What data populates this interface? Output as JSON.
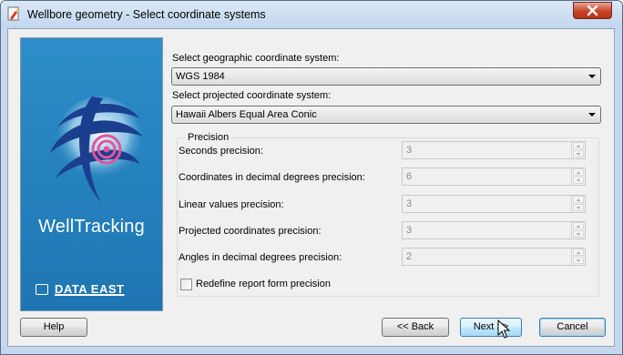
{
  "window": {
    "title": "Wellbore geometry - Select coordinate systems",
    "app_icon": "document-pencil-icon",
    "close_icon": "close-x-icon"
  },
  "banner": {
    "brand": "WellTracking",
    "vendor": "DATA EAST",
    "logo_icon": "globe-target-icon",
    "colors": {
      "background": "#2684c0",
      "globe": "#1b3f8f",
      "target": "#e0559b"
    }
  },
  "geo": {
    "label": "Select geographic coordinate system:",
    "value": "WGS 1984"
  },
  "proj": {
    "label": "Select projected coordinate system:",
    "value": "Hawaii Albers Equal Area Conic"
  },
  "precision": {
    "legend": "Precision",
    "rows": [
      {
        "label": "Seconds precision:",
        "value": "3"
      },
      {
        "label": "Coordinates in decimal degrees  precision:",
        "value": "6"
      },
      {
        "label": "Linear values precision:",
        "value": "3"
      },
      {
        "label": "Projected coordinates precision:",
        "value": "3"
      },
      {
        "label": "Angles in decimal degrees precision:",
        "value": "2"
      }
    ],
    "redefine_label": "Redefine report form precision",
    "redefine_checked": false
  },
  "buttons": {
    "help": "Help",
    "back": "<< Back",
    "next": "Next >>",
    "cancel": "Cancel"
  }
}
